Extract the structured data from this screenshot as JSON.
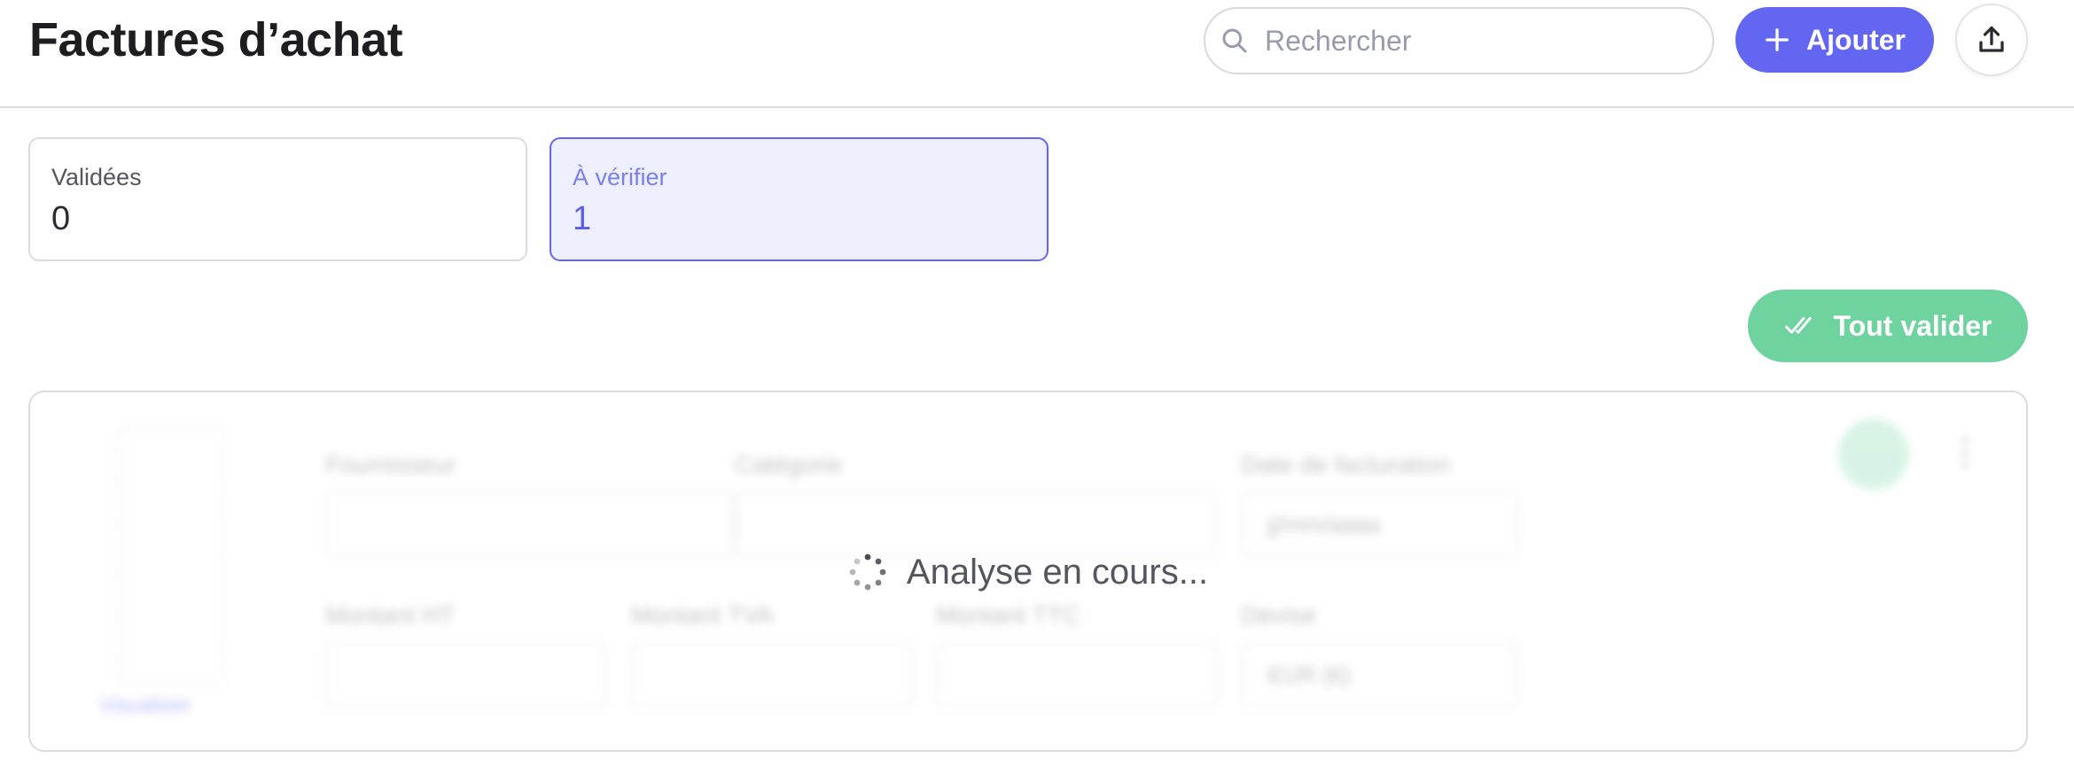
{
  "header": {
    "title": "Factures d’achat",
    "search_placeholder": "Rechercher",
    "add_label": "Ajouter"
  },
  "stats": [
    {
      "label": "Validées",
      "value": "0"
    },
    {
      "label": "À vérifier",
      "value": "1"
    }
  ],
  "actions": {
    "validate_all_label": "Tout valider"
  },
  "invoice": {
    "loading_text": "Analyse en cours...",
    "thumbnail_link": "Visualiser",
    "fields": {
      "supplier_label": "Fournisseur",
      "category_label": "Catégorie",
      "date_label": "Date de facturation",
      "date_placeholder": "jj/mm/aaaa",
      "amount_ht_label": "Montant HT",
      "amount_tva_label": "Montant TVA",
      "amount_ttc_label": "Montant TTC",
      "currency_label": "Devise",
      "currency_value": "EUR (€)"
    }
  },
  "colors": {
    "accent": "#6366f1",
    "success": "#6fd3a0",
    "highlight_bg": "#eeeffc",
    "border": "#dcdcdf"
  }
}
